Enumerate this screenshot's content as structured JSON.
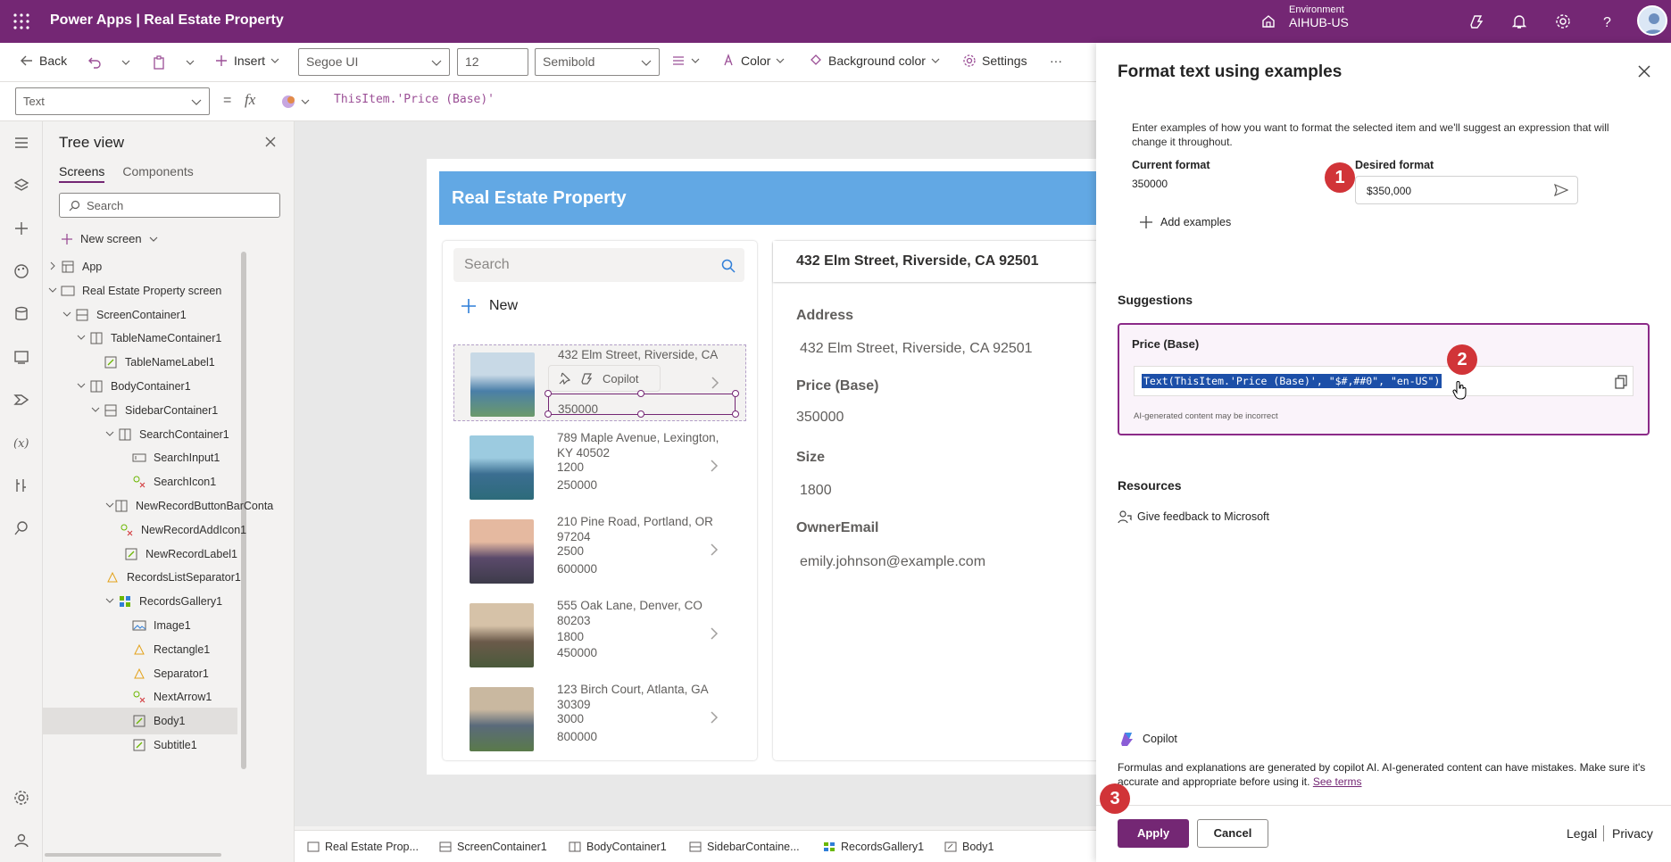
{
  "app": {
    "title": "Power Apps | Real Estate Property",
    "environment_label": "Environment",
    "environment_name": "AIHUB-US"
  },
  "commandbar": {
    "back": "Back",
    "insert": "Insert",
    "font": "Segoe UI",
    "font_size": "12",
    "font_weight": "Semibold",
    "color": "Color",
    "background_color": "Background color",
    "settings": "Settings",
    "more": "···"
  },
  "formulabar": {
    "property": "Text",
    "equals": "=",
    "fx": "fx",
    "formula": "ThisItem.'Price (Base)'"
  },
  "tree": {
    "title": "Tree view",
    "tabs": [
      "Screens",
      "Components"
    ],
    "search_placeholder": "Search",
    "new_screen": "New screen",
    "items": [
      {
        "label": "App",
        "icon": "app-icon"
      },
      {
        "label": "Real Estate Property screen",
        "icon": "screen-icon"
      },
      {
        "label": "ScreenContainer1",
        "icon": "container-icon"
      },
      {
        "label": "TableNameContainer1",
        "icon": "horizontal-container-icon"
      },
      {
        "label": "TableNameLabel1",
        "icon": "label-icon"
      },
      {
        "label": "BodyContainer1",
        "icon": "horizontal-container-icon"
      },
      {
        "label": "SidebarContainer1",
        "icon": "container-icon"
      },
      {
        "label": "SearchContainer1",
        "icon": "horizontal-container-icon"
      },
      {
        "label": "SearchInput1",
        "icon": "text-input-icon"
      },
      {
        "label": "SearchIcon1",
        "icon": "icon-control-icon"
      },
      {
        "label": "NewRecordButtonBarConta",
        "icon": "horizontal-container-icon"
      },
      {
        "label": "NewRecordAddIcon1",
        "icon": "icon-control-icon"
      },
      {
        "label": "NewRecordLabel1",
        "icon": "label-icon"
      },
      {
        "label": "RecordsListSeparator1",
        "icon": "shape-icon"
      },
      {
        "label": "RecordsGallery1",
        "icon": "gallery-icon"
      },
      {
        "label": "Image1",
        "icon": "image-icon"
      },
      {
        "label": "Rectangle1",
        "icon": "shape-icon"
      },
      {
        "label": "Separator1",
        "icon": "shape-icon"
      },
      {
        "label": "NextArrow1",
        "icon": "icon-control-icon"
      },
      {
        "label": "Body1",
        "icon": "label-icon"
      },
      {
        "label": "Subtitle1",
        "icon": "label-icon"
      }
    ]
  },
  "canvas": {
    "header": "Real Estate Property",
    "search_placeholder": "Search",
    "new_label": "New",
    "toolbar_copilot": "Copilot",
    "records": [
      {
        "address": "432 Elm Street, Riverside, CA",
        "size": "",
        "price": "350000"
      },
      {
        "address": "789 Maple Avenue, Lexington, KY 40502",
        "size": "1200",
        "price": "250000"
      },
      {
        "address": "210 Pine Road, Portland, OR 97204",
        "size": "2500",
        "price": "600000"
      },
      {
        "address": "555 Oak Lane, Denver, CO 80203",
        "size": "1800",
        "price": "450000"
      },
      {
        "address": "123 Birch Court, Atlanta, GA 30309",
        "size": "3000",
        "price": "800000"
      }
    ],
    "detail": {
      "title": "432 Elm Street, Riverside, CA 92501",
      "fields": [
        {
          "label": "Address",
          "value": "432 Elm Street, Riverside, CA 92501"
        },
        {
          "label": "Price (Base)",
          "value": "350000"
        },
        {
          "label": "Size",
          "value": "1800"
        },
        {
          "label": "OwnerEmail",
          "value": "emily.johnson@example.com"
        }
      ]
    }
  },
  "statusbar": {
    "crumbs": [
      "Real Estate Prop...",
      "ScreenContainer1",
      "BodyContainer1",
      "SidebarContaine...",
      "RecordsGallery1",
      "Body1"
    ]
  },
  "pane": {
    "title": "Format text using examples",
    "description": "Enter examples of how you want to format the selected item and we'll suggest an expression that will change it throughout.",
    "current_format_label": "Current format",
    "current_format_value": "350000",
    "desired_format_label": "Desired format",
    "desired_format_value": "$350,000",
    "add_examples": "Add examples",
    "suggestions_heading": "Suggestions",
    "suggestion_title": "Price (Base)",
    "suggestion_code": "Text(ThisItem.'Price (Base)', \"$#,##0\", \"en-US\")",
    "ai_note": "AI-generated content may be incorrect",
    "resources_heading": "Resources",
    "feedback": "Give feedback to Microsoft",
    "copilot_label": "Copilot",
    "footer_text": "Formulas and explanations are generated by copilot AI. AI-generated content can have mistakes. Make sure it's accurate and appropriate before using it.",
    "see_terms": "See terms",
    "apply": "Apply",
    "cancel": "Cancel",
    "legal": "Legal",
    "privacy": "Privacy",
    "steps": [
      "1",
      "2",
      "3"
    ]
  },
  "colors": {
    "brand": "#742774",
    "header_blue": "#62a8e4",
    "badge_red": "#d13438",
    "selection_blue": "#1c4fa8"
  }
}
